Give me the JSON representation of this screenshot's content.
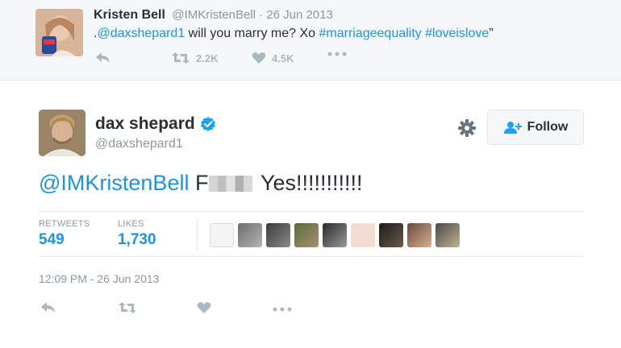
{
  "reply_to": {
    "name": "Kristen Bell",
    "handle": "@IMKristenBell",
    "date": "26 Jun 2013",
    "text_prefix": ".",
    "mention": "@daxshepard1",
    "text_body": " will you marry me? Xo ",
    "hashtag1": "#marriageequality",
    "hashtag2": "#loveislove",
    "text_suffix": "”",
    "retweets": "2.2K",
    "likes": "4.5K",
    "icons": [
      "reply-icon",
      "retweet-icon",
      "heart-icon",
      "more-icon"
    ]
  },
  "tweet": {
    "name": "dax shepard",
    "verified": true,
    "handle": "@daxshepard1",
    "follow_label": "Follow",
    "text_mention": "@IMKristenBell",
    "text_censored_prefix": "F",
    "text_rest": "Yes!!!!!!!!!!!",
    "retweets_label": "RETWEETS",
    "retweets_count": "549",
    "likes_label": "LIKES",
    "likes_count": "1,730",
    "timestamp": "12:09 PM - 26 Jun 2013"
  },
  "colors": {
    "link": "#1b95e0",
    "muted": "#8899a6",
    "icon": "#aab8c2",
    "text": "#292f33",
    "verified": "#1da1f2"
  }
}
